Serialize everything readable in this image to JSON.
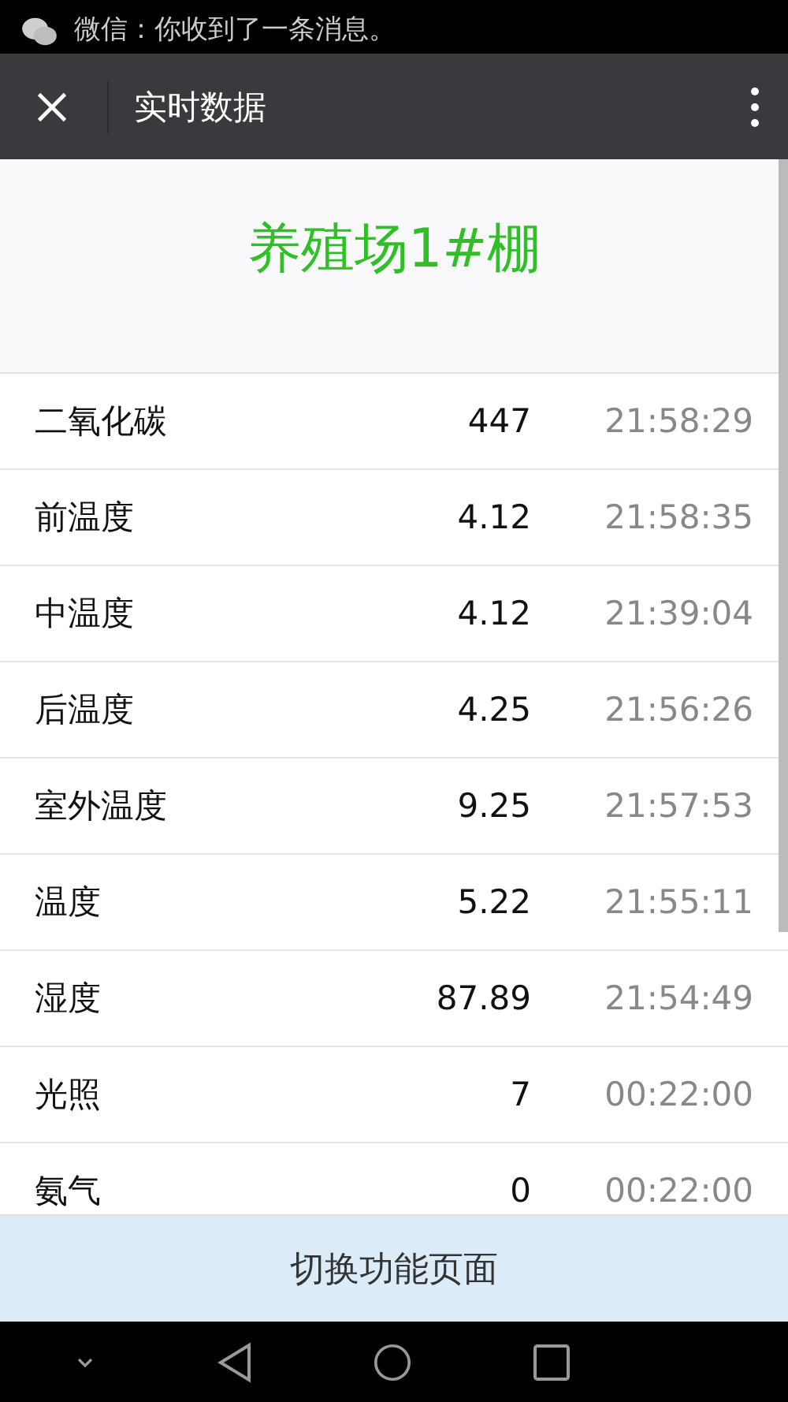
{
  "notification": {
    "text": "微信：你收到了一条消息。"
  },
  "header": {
    "title": "实时数据"
  },
  "farm": {
    "title": "养殖场1#棚"
  },
  "readings": [
    {
      "name": "二氧化碳",
      "value": "447",
      "time": "21:58:29"
    },
    {
      "name": "前温度",
      "value": "4.12",
      "time": "21:58:35"
    },
    {
      "name": "中温度",
      "value": "4.12",
      "time": "21:39:04"
    },
    {
      "name": "后温度",
      "value": "4.25",
      "time": "21:56:26"
    },
    {
      "name": "室外温度",
      "value": "9.25",
      "time": "21:57:53"
    },
    {
      "name": "温度",
      "value": "5.22",
      "time": "21:55:11"
    },
    {
      "name": "湿度",
      "value": "87.89",
      "time": "21:54:49"
    },
    {
      "name": "光照",
      "value": "7",
      "time": "00:22:00"
    },
    {
      "name": "氨气",
      "value": "0",
      "time": "00:22:00"
    }
  ],
  "footer_button": {
    "label": "切换功能页面"
  }
}
